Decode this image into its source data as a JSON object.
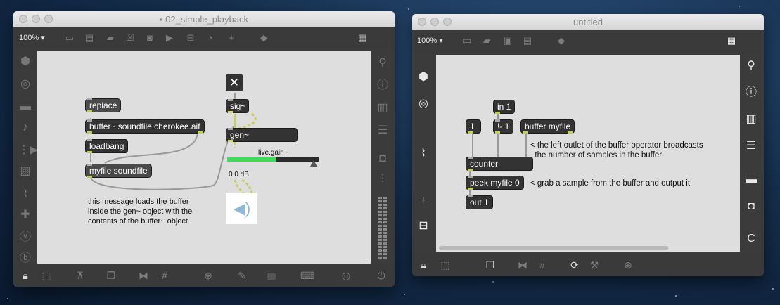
{
  "windows": {
    "left": {
      "title": "02_simple_playback",
      "zoom": "100% ▾",
      "objects": {
        "replace": "replace",
        "buffer": "buffer~ soundfile cherokee.aif",
        "loadbang": "loadbang",
        "myfile": "myfile soundfile",
        "toggle": "✕",
        "sig": "sig~",
        "gen": "gen~",
        "gain_label": "live.gain~",
        "gain_value": "0.0 dB"
      },
      "gain_level": 0.54,
      "comment": [
        "this message loads the buffer",
        "inside the gen~ object with the",
        "contents of the buffer~ object"
      ]
    },
    "right": {
      "title": "untitled",
      "zoom": "100% ▾",
      "objects": {
        "in1": "in 1",
        "one": "1",
        "nminus": "!- 1",
        "buffer": "buffer myfile",
        "counter": "counter",
        "peek": "peek myfile 0",
        "out": "out 1"
      },
      "comment1": [
        "< the left outlet of the buffer operator broadcasts",
        "  the number of samples in the buffer"
      ],
      "comment2": "< grab a sample from the buffer and output it"
    }
  },
  "colors": {
    "canvas": "#dedede",
    "chrome": "#3a3a3a",
    "object": "#333333",
    "meter_green": "#3fdc5a",
    "signal_cord": "#c8cf5e"
  }
}
